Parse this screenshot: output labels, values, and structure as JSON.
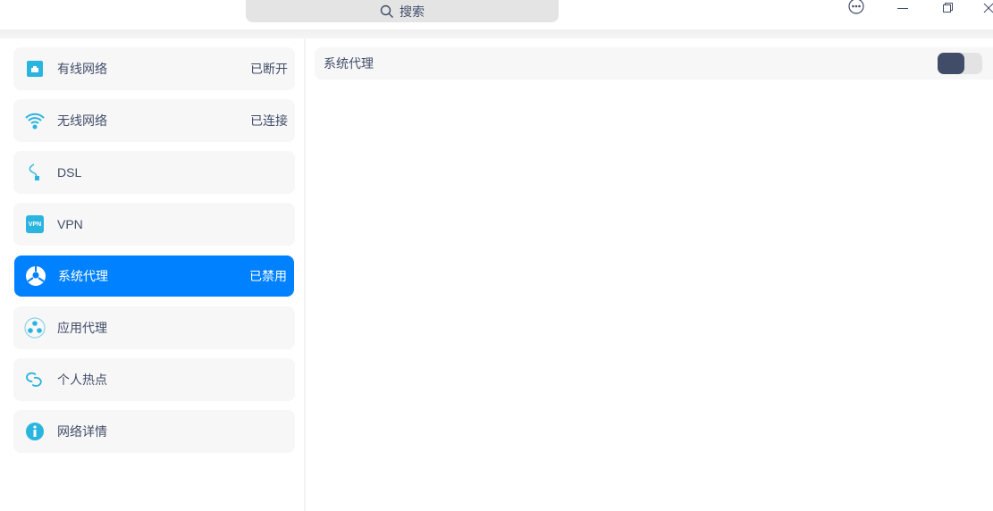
{
  "titlebar": {
    "search_label": "搜索"
  },
  "sidebar": {
    "items": [
      {
        "label": "有线网络",
        "status": "已断开",
        "icon": "wired-network-icon"
      },
      {
        "label": "无线网络",
        "status": "已连接",
        "icon": "wifi-icon"
      },
      {
        "label": "DSL",
        "status": "",
        "icon": "dsl-icon"
      },
      {
        "label": "VPN",
        "status": "",
        "icon": "vpn-icon",
        "icon_text": "VPN"
      },
      {
        "label": "系统代理",
        "status": "已禁用",
        "icon": "system-proxy-icon",
        "active": true
      },
      {
        "label": "应用代理",
        "status": "",
        "icon": "app-proxy-icon"
      },
      {
        "label": "个人热点",
        "status": "",
        "icon": "hotspot-icon"
      },
      {
        "label": "网络详情",
        "status": "",
        "icon": "info-icon"
      }
    ]
  },
  "main": {
    "system_proxy_label": "系统代理",
    "system_proxy_enabled": false
  },
  "colors": {
    "accent": "#0081ff",
    "icon": "#2ab4e0",
    "text": "#414d68"
  }
}
